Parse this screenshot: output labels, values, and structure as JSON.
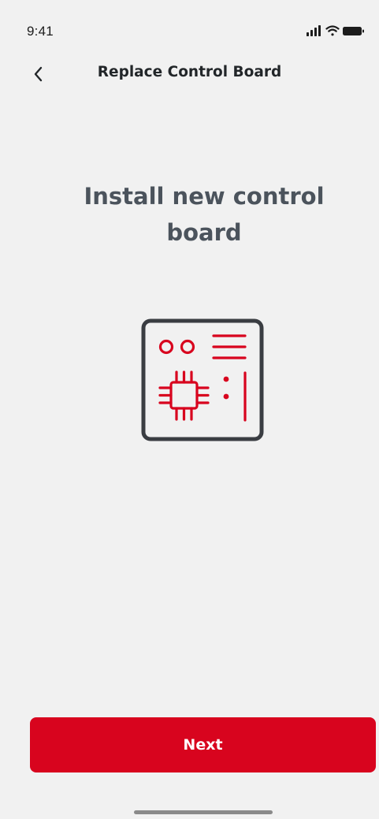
{
  "status_bar": {
    "time": "9:41",
    "icons": [
      "cellular-signal-icon",
      "wifi-icon",
      "battery-icon"
    ]
  },
  "nav": {
    "back_icon": "chevron-left-icon",
    "title": "Replace Control Board"
  },
  "main": {
    "headline": "Install new control board",
    "illustration_icon": "control-board-icon"
  },
  "footer": {
    "next_label": "Next"
  },
  "colors": {
    "accent": "#d8041e",
    "background": "#f1f1f1",
    "headline_text": "#4b535c",
    "title_text": "#222629",
    "icon_frame": "#3a3d42"
  }
}
